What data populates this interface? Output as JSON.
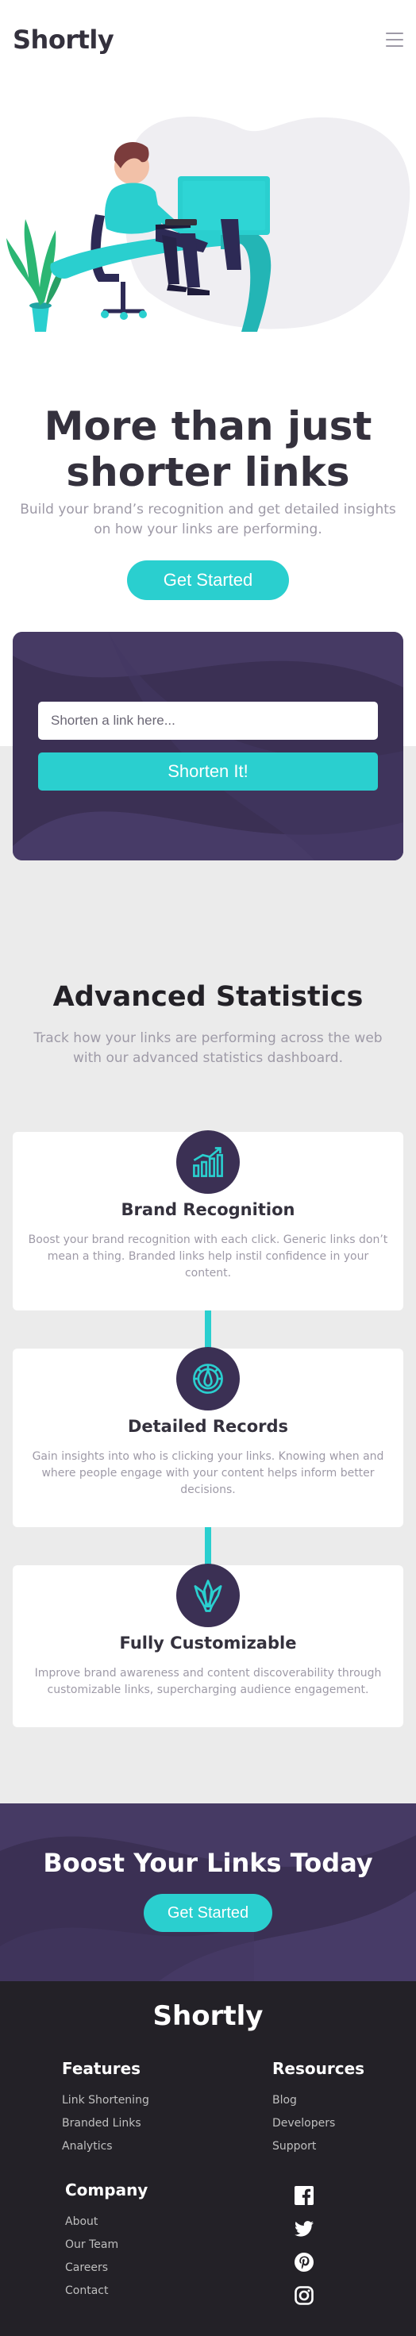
{
  "header": {
    "logo": "Shortly",
    "menu_icon": "hamburger-menu-icon"
  },
  "hero": {
    "illustration": "person-working-at-desk-illustration",
    "title": "More than just shorter links",
    "subtitle": "Build your brand’s recognition and get detailed insights on how your links are performing.",
    "cta_label": "Get Started"
  },
  "shorten": {
    "placeholder": "Shorten a link here...",
    "button_label": "Shorten It!"
  },
  "stats": {
    "title": "Advanced Statistics",
    "subtitle": "Track how your links are performing across the web with our advanced statistics dashboard.",
    "features": [
      {
        "icon": "bar-chart-icon",
        "title": "Brand Recognition",
        "description": "Boost your brand recognition with each click. Generic links don’t mean a thing. Branded links help instil confidence in your content."
      },
      {
        "icon": "gauge-icon",
        "title": "Detailed Records",
        "description": "Gain insights into who is clicking your links. Knowing when and where people engage with your content helps inform better decisions."
      },
      {
        "icon": "brushes-icon",
        "title": "Fully Customizable",
        "description": "Improve brand awareness and content discoverability through customizable links, supercharging audience engagement."
      }
    ]
  },
  "boost": {
    "title": "Boost Your Links Today",
    "cta_label": "Get Started"
  },
  "footer": {
    "logo": "Shortly",
    "features": {
      "heading": "Features",
      "links": [
        "Link Shortening",
        "Branded Links",
        "Analytics"
      ]
    },
    "resources": {
      "heading": "Resources",
      "links": [
        "Blog",
        "Developers",
        "Support"
      ]
    },
    "company": {
      "heading": "Company",
      "links": [
        "About",
        "Our Team",
        "Careers",
        "Contact"
      ]
    },
    "socials": [
      "facebook-icon",
      "twitter-icon",
      "pinterest-icon",
      "instagram-icon"
    ]
  },
  "colors": {
    "accent": "#2acfcf",
    "dark_violet": "#3b3054",
    "very_dark": "#232127",
    "gray": "#9e9aa7"
  }
}
